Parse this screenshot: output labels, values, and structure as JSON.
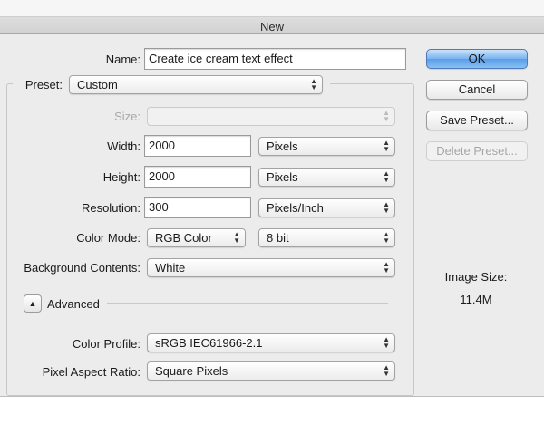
{
  "window": {
    "title": "New"
  },
  "form": {
    "name": {
      "label": "Name:",
      "value": "Create ice cream text effect"
    },
    "preset": {
      "label": "Preset:",
      "value": "Custom"
    },
    "size": {
      "label": "Size:",
      "value": ""
    },
    "width": {
      "label": "Width:",
      "value": "2000",
      "unit": "Pixels"
    },
    "height": {
      "label": "Height:",
      "value": "2000",
      "unit": "Pixels"
    },
    "resolution": {
      "label": "Resolution:",
      "value": "300",
      "unit": "Pixels/Inch"
    },
    "color_mode": {
      "label": "Color Mode:",
      "value": "RGB Color",
      "depth": "8 bit"
    },
    "background": {
      "label": "Background Contents:",
      "value": "White"
    },
    "advanced": {
      "label": "Advanced"
    },
    "color_profile": {
      "label": "Color Profile:",
      "value": "sRGB IEC61966-2.1"
    },
    "pixel_aspect": {
      "label": "Pixel Aspect Ratio:",
      "value": "Square Pixels"
    }
  },
  "buttons": {
    "ok": "OK",
    "cancel": "Cancel",
    "save_preset": "Save Preset...",
    "delete_preset": "Delete Preset..."
  },
  "image_size": {
    "label": "Image Size:",
    "value": "11.4M"
  },
  "colors": {
    "default_button": "#5a9ee9",
    "dialog_bg": "#ececec"
  }
}
